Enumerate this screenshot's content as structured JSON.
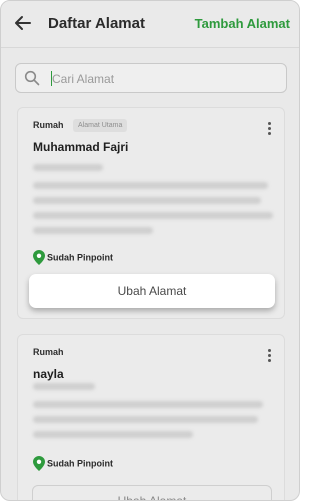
{
  "header": {
    "title": "Daftar Alamat",
    "add_label": "Tambah Alamat"
  },
  "search": {
    "placeholder": "Cari Alamat"
  },
  "addresses": [
    {
      "type": "Rumah",
      "badge": "Alamat Utama",
      "name": "Muhammad Fajri",
      "pinpoint": "Sudah Pinpoint",
      "edit_label": "Ubah Alamat"
    },
    {
      "type": "Rumah",
      "name": "nayla",
      "pinpoint": "Sudah Pinpoint",
      "edit_label": "Ubah Alamat"
    }
  ],
  "colors": {
    "accent": "#2e9a3d",
    "background": "#e9e9e9"
  },
  "icons": [
    "back-arrow-icon",
    "search-icon",
    "more-vertical-icon",
    "location-pin-icon"
  ]
}
